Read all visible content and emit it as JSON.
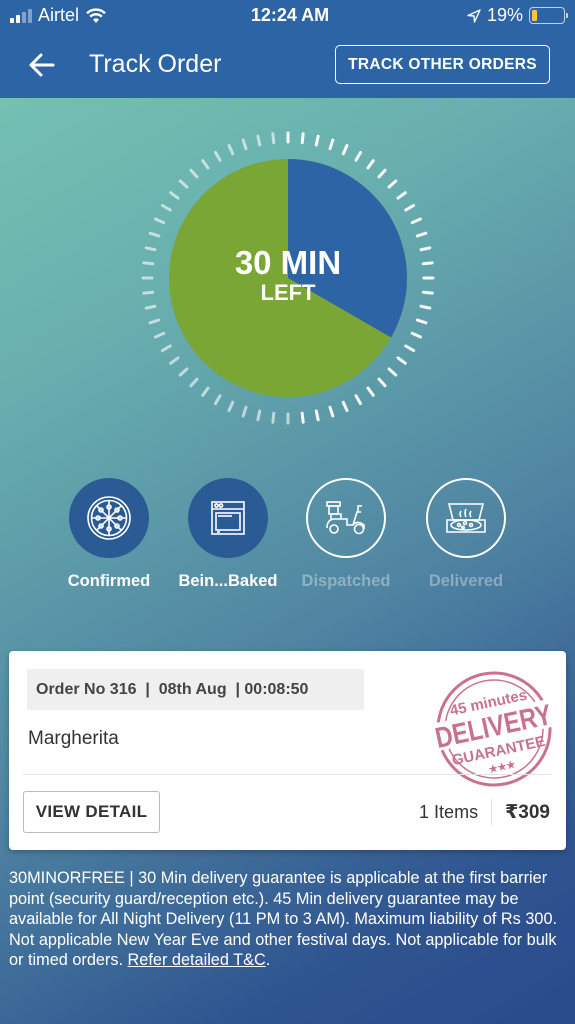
{
  "status_bar": {
    "carrier": "Airtel",
    "time": "12:24 AM",
    "battery_percent_label": "19%",
    "battery_level": 0.19,
    "signal_bars_active": 2,
    "signal_bars_total": 4
  },
  "header": {
    "title": "Track Order",
    "back_icon": "arrow-left-icon",
    "track_other_orders_label": "TRACK OTHER ORDERS"
  },
  "timer": {
    "value_label": "30 MIN",
    "suffix_label": "LEFT",
    "minutes_left": 30,
    "total_minutes": 45,
    "elapsed_fraction": 0.3333,
    "colors": {
      "remaining": "#79a634",
      "elapsed": "#2d64a6"
    }
  },
  "steps": [
    {
      "label": "Confirmed",
      "icon": "pizza-icon",
      "done": true
    },
    {
      "label": "Bein...Baked",
      "icon": "oven-icon",
      "done": true
    },
    {
      "label": "Dispatched",
      "icon": "scooter-icon",
      "done": false
    },
    {
      "label": "Delivered",
      "icon": "pizza-box-icon",
      "done": false
    }
  ],
  "order": {
    "meta": "Order No 316  |  08th Aug  | 00:08:50",
    "order_no": "316",
    "date": "08th Aug",
    "time": "00:08:50",
    "item_name": "Margherita",
    "view_detail_label": "VIEW DETAIL",
    "items_count_label": "1 Items",
    "price": "₹309",
    "stamp": {
      "line1": "45 minutes",
      "line2": "DELIVERY",
      "line3": "GUARANTEE",
      "stars": "★★★",
      "color": "#c9728b"
    }
  },
  "disclaimer": {
    "text": "30MINORFREE | 30 Min delivery guarantee is applicable at the first barrier point (security guard/reception etc.). 45 Min delivery guarantee may be available for All Night Delivery (11 PM to 3 AM). Maximum liability of Rs 300. Not applicable New Year Eve and other festival days. Not applicable for bulk or timed orders. ",
    "link_label": "Refer detailed T&C",
    "trailing": "."
  },
  "colors": {
    "header_bg": "#2d64a6",
    "gradient_start": "#78c6b4",
    "gradient_end": "#294a8b"
  }
}
